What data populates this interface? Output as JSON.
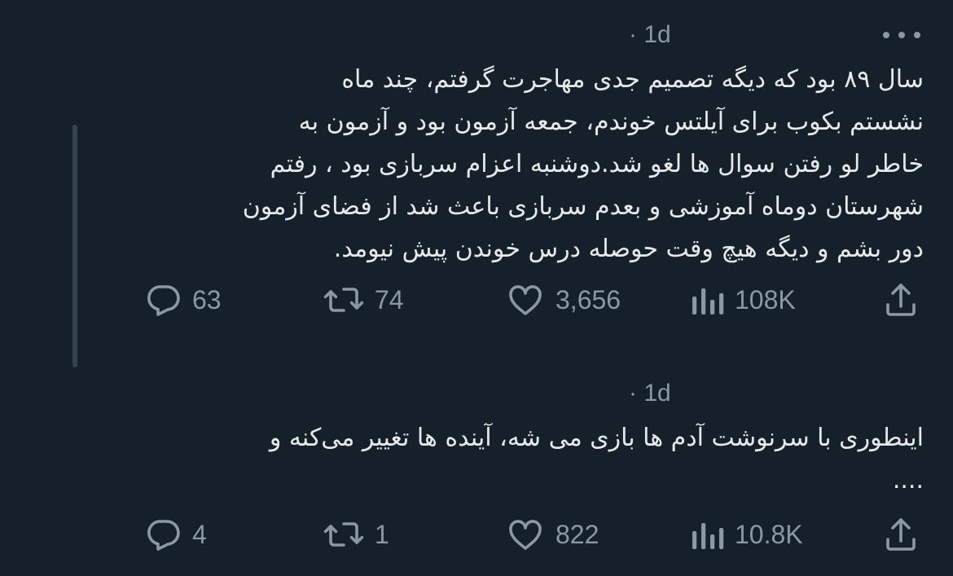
{
  "tweets": [
    {
      "timestamp": "· 1d",
      "text_lines": [
        "سال ۸۹ بود که دیگه تصمیم جدی مهاجرت گرفتم، چند ماه",
        "نشستم بکوب برای آیلتس خوندم، جمعه آزمون بود و آزمون به",
        "خاطر لو رفتن سوال ها لغو شد.دوشنبه اعزام سربازی بود ، رفتم",
        "شهرستان دوماه آموزشی و بعدم سربازی باعث شد از فضای آزمون",
        "دور بشم و دیگه هیچ وقت حوصله درس خوندن پیش نیومد."
      ],
      "replies": "63",
      "retweets": "74",
      "likes": "3,656",
      "views": "108K"
    },
    {
      "timestamp": "· 1d",
      "text_lines": [
        "اینطوری با سرنوشت آدم ها بازی می شه، آینده ها تغییر می‌کنه و",
        "...."
      ],
      "replies": "4",
      "retweets": "1",
      "likes": "822",
      "views": "10.8K"
    }
  ],
  "icons": {
    "reply": "reply-icon",
    "retweet": "retweet-icon",
    "like": "heart-icon",
    "views": "views-icon",
    "share": "share-icon",
    "more": "more-icon"
  },
  "colors": {
    "background": "#15202b",
    "text": "#e7e9ea",
    "muted": "#8b98a5",
    "thread_line": "#38444d"
  }
}
